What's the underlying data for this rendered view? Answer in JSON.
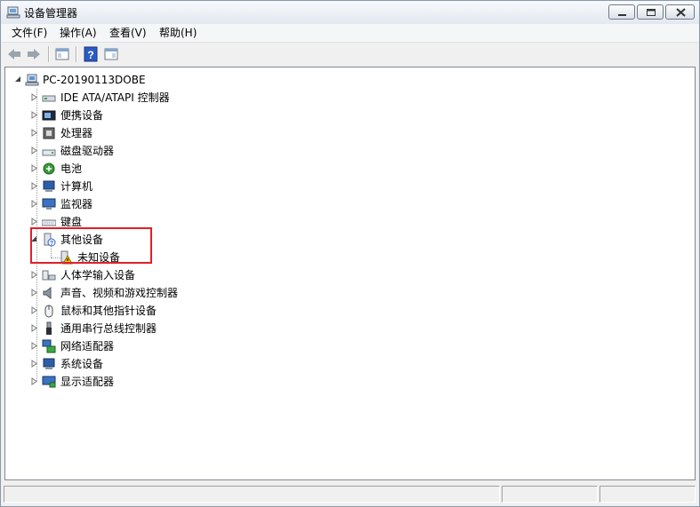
{
  "window": {
    "title": "设备管理器"
  },
  "menu": [
    {
      "label": "文件(F)"
    },
    {
      "label": "操作(A)"
    },
    {
      "label": "查看(V)"
    },
    {
      "label": "帮助(H)"
    }
  ],
  "tree": {
    "root": "PC-20190113DOBE",
    "categories": [
      {
        "label": "IDE ATA/ATAPI 控制器",
        "icon": "ide-controller-icon"
      },
      {
        "label": "便携设备",
        "icon": "portable-device-icon"
      },
      {
        "label": "处理器",
        "icon": "processor-icon"
      },
      {
        "label": "磁盘驱动器",
        "icon": "disk-drive-icon"
      },
      {
        "label": "电池",
        "icon": "battery-icon"
      },
      {
        "label": "计算机",
        "icon": "computer-icon"
      },
      {
        "label": "监视器",
        "icon": "monitor-icon"
      },
      {
        "label": "键盘",
        "icon": "keyboard-icon"
      },
      {
        "label": "其他设备",
        "icon": "other-devices-icon",
        "expanded": true,
        "children": [
          {
            "label": "未知设备",
            "icon": "unknown-device-warning-icon"
          }
        ]
      },
      {
        "label": "人体学输入设备",
        "icon": "hid-icon"
      },
      {
        "label": "声音、视频和游戏控制器",
        "icon": "sound-icon"
      },
      {
        "label": "鼠标和其他指针设备",
        "icon": "mouse-icon"
      },
      {
        "label": "通用串行总线控制器",
        "icon": "usb-icon"
      },
      {
        "label": "网络适配器",
        "icon": "network-adapter-icon"
      },
      {
        "label": "系统设备",
        "icon": "system-device-icon"
      },
      {
        "label": "显示适配器",
        "icon": "display-adapter-icon"
      }
    ]
  },
  "colors": {
    "highlight_border": "#e0202a",
    "warning": "#f5c400"
  }
}
